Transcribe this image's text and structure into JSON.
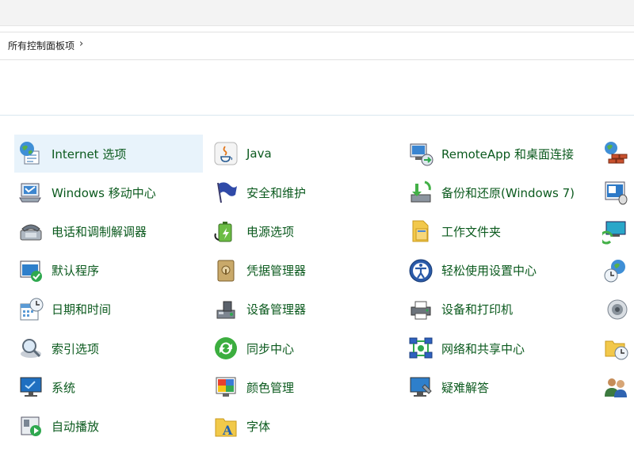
{
  "breadcrumb": {
    "root": "所有控制面板项",
    "separator": "›"
  },
  "colors": {
    "label": "#0b5a1e",
    "highlight": "#e8f3fb"
  },
  "columns": [
    [
      {
        "label": "Internet 选项",
        "icon": "globe-icon",
        "highlighted": true
      },
      {
        "label": "Windows 移动中心",
        "icon": "mobility-center-icon"
      },
      {
        "label": "电话和调制解调器",
        "icon": "phone-modem-icon"
      },
      {
        "label": "默认程序",
        "icon": "default-programs-icon"
      },
      {
        "label": "日期和时间",
        "icon": "calendar-clock-icon"
      },
      {
        "label": "索引选项",
        "icon": "index-magnifier-icon"
      },
      {
        "label": "系统",
        "icon": "system-monitor-icon"
      },
      {
        "label": "自动播放",
        "icon": "autoplay-icon"
      }
    ],
    [
      {
        "label": "Java",
        "icon": "java-icon"
      },
      {
        "label": "安全和维护",
        "icon": "security-flag-icon"
      },
      {
        "label": "电源选项",
        "icon": "power-battery-icon"
      },
      {
        "label": "凭据管理器",
        "icon": "credential-vault-icon"
      },
      {
        "label": "设备管理器",
        "icon": "device-manager-icon"
      },
      {
        "label": "同步中心",
        "icon": "sync-center-icon"
      },
      {
        "label": "颜色管理",
        "icon": "color-management-icon"
      },
      {
        "label": "字体",
        "icon": "fonts-icon"
      }
    ],
    [
      {
        "label": "RemoteApp 和桌面连接",
        "icon": "remoteapp-icon"
      },
      {
        "label": "备份和还原(Windows 7)",
        "icon": "backup-restore-icon"
      },
      {
        "label": "工作文件夹",
        "icon": "work-folders-icon"
      },
      {
        "label": "轻松使用设置中心",
        "icon": "ease-of-access-icon"
      },
      {
        "label": "设备和打印机",
        "icon": "printer-icon"
      },
      {
        "label": "网络和共享中心",
        "icon": "network-icon"
      },
      {
        "label": "疑难解答",
        "icon": "troubleshoot-icon"
      }
    ],
    [
      {
        "label": "",
        "icon": "firewall-icon"
      },
      {
        "label": "",
        "icon": "mouse-icon"
      },
      {
        "label": "",
        "icon": "recovery-icon"
      },
      {
        "label": "",
        "icon": "region-icon"
      },
      {
        "label": "",
        "icon": "sound-icon"
      },
      {
        "label": "",
        "icon": "file-history-icon"
      },
      {
        "label": "",
        "icon": "user-accounts-icon"
      }
    ]
  ]
}
